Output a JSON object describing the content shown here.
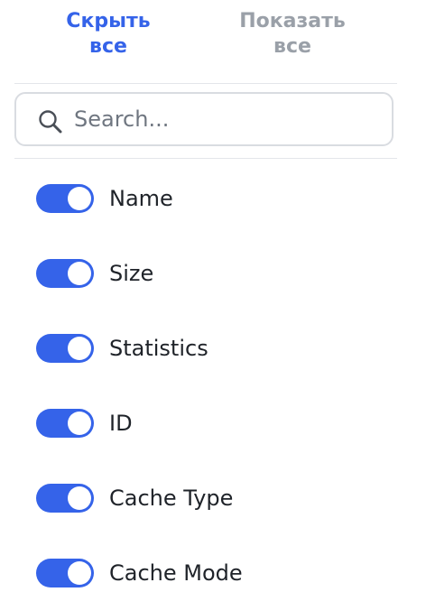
{
  "header": {
    "hide_all_label": "Скрыть\nвсе",
    "show_all_label": "Показать\nвсе"
  },
  "search": {
    "placeholder": "Search...",
    "value": ""
  },
  "colors": {
    "accent": "#3563e9",
    "inactive_action": "#9aa0a8"
  },
  "columns": [
    {
      "label": "Name",
      "enabled": true
    },
    {
      "label": "Size",
      "enabled": true
    },
    {
      "label": "Statistics",
      "enabled": true
    },
    {
      "label": "ID",
      "enabled": true
    },
    {
      "label": "Cache Type",
      "enabled": true
    },
    {
      "label": "Cache Mode",
      "enabled": true
    }
  ]
}
